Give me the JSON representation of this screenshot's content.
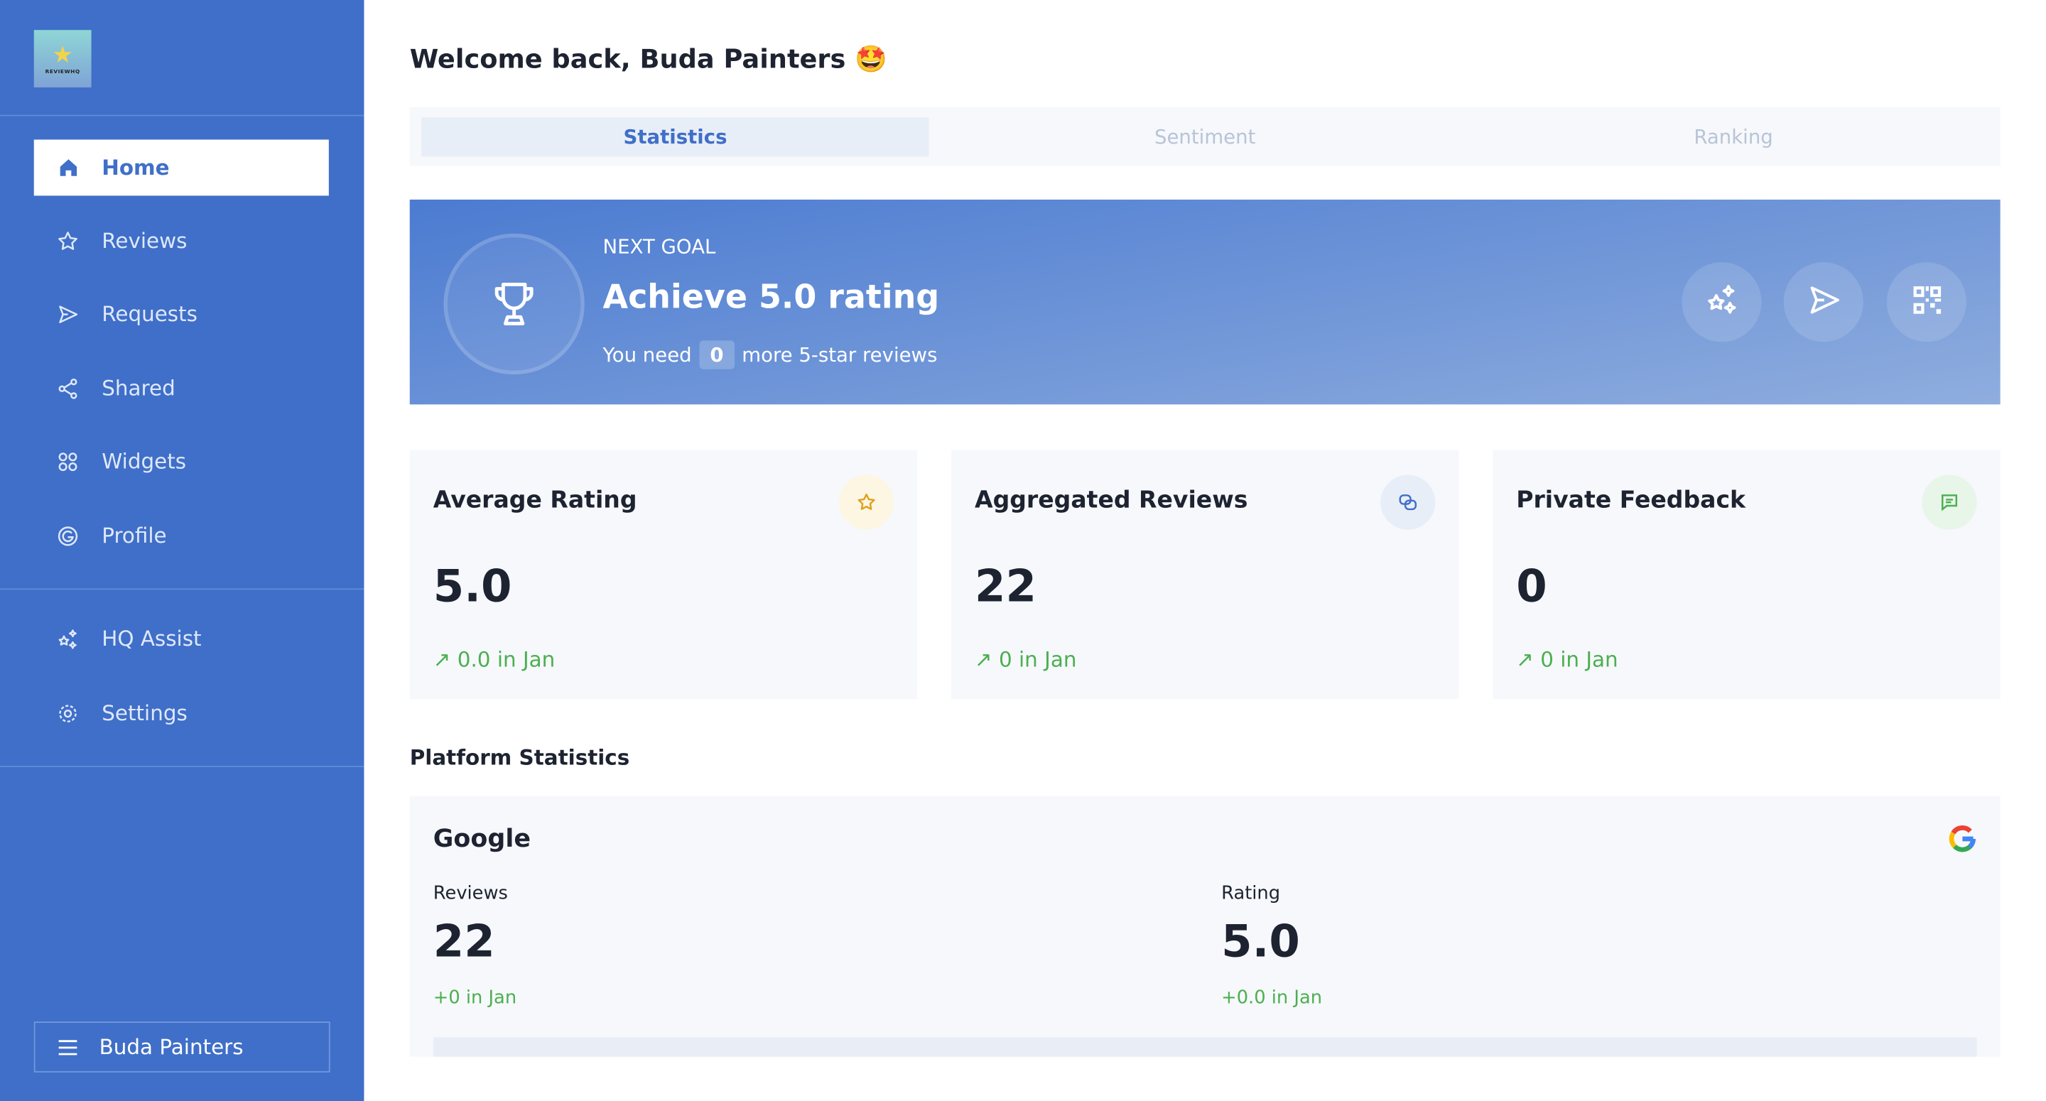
{
  "sidebar": {
    "logo_text": "REVIEWHQ",
    "items": [
      {
        "label": "Home",
        "icon": "home-icon"
      },
      {
        "label": "Reviews",
        "icon": "star-icon"
      },
      {
        "label": "Requests",
        "icon": "send-icon"
      },
      {
        "label": "Shared",
        "icon": "share-icon"
      },
      {
        "label": "Widgets",
        "icon": "widgets-icon"
      },
      {
        "label": "Profile",
        "icon": "google-icon"
      },
      {
        "label": "HQ Assist",
        "icon": "sparkle-icon"
      },
      {
        "label": "Settings",
        "icon": "gear-icon"
      }
    ],
    "account_label": "Buda Painters"
  },
  "header": {
    "title": "Welcome back, Buda Painters",
    "emoji": "🤩"
  },
  "tabs": [
    {
      "label": "Statistics"
    },
    {
      "label": "Sentiment"
    },
    {
      "label": "Ranking"
    }
  ],
  "goal": {
    "label": "NEXT GOAL",
    "title": "Achieve 5.0 rating",
    "sub_pre": "You need",
    "count": "0",
    "sub_post": "more 5-star reviews"
  },
  "cards": [
    {
      "title": "Average Rating",
      "value": "5.0",
      "change": "↗ 0.0 in Jan",
      "icon_color": "#e0a020",
      "icon_bg": "#fdf6e3"
    },
    {
      "title": "Aggregated Reviews",
      "value": "22",
      "change": "↗ 0 in Jan",
      "icon_color": "#3f6fc8",
      "icon_bg": "#e8eef8"
    },
    {
      "title": "Private Feedback",
      "value": "0",
      "change": "↗ 0 in Jan",
      "icon_color": "#4caf50",
      "icon_bg": "#e8f5e9"
    }
  ],
  "platform": {
    "section_title": "Platform Statistics",
    "name": "Google",
    "reviews_label": "Reviews",
    "reviews_value": "22",
    "reviews_change": "+0 in Jan",
    "rating_label": "Rating",
    "rating_value": "5.0",
    "rating_change": "+0.0 in Jan"
  },
  "colors": {
    "brand": "#3f6fc8",
    "positive": "#4caf50"
  }
}
